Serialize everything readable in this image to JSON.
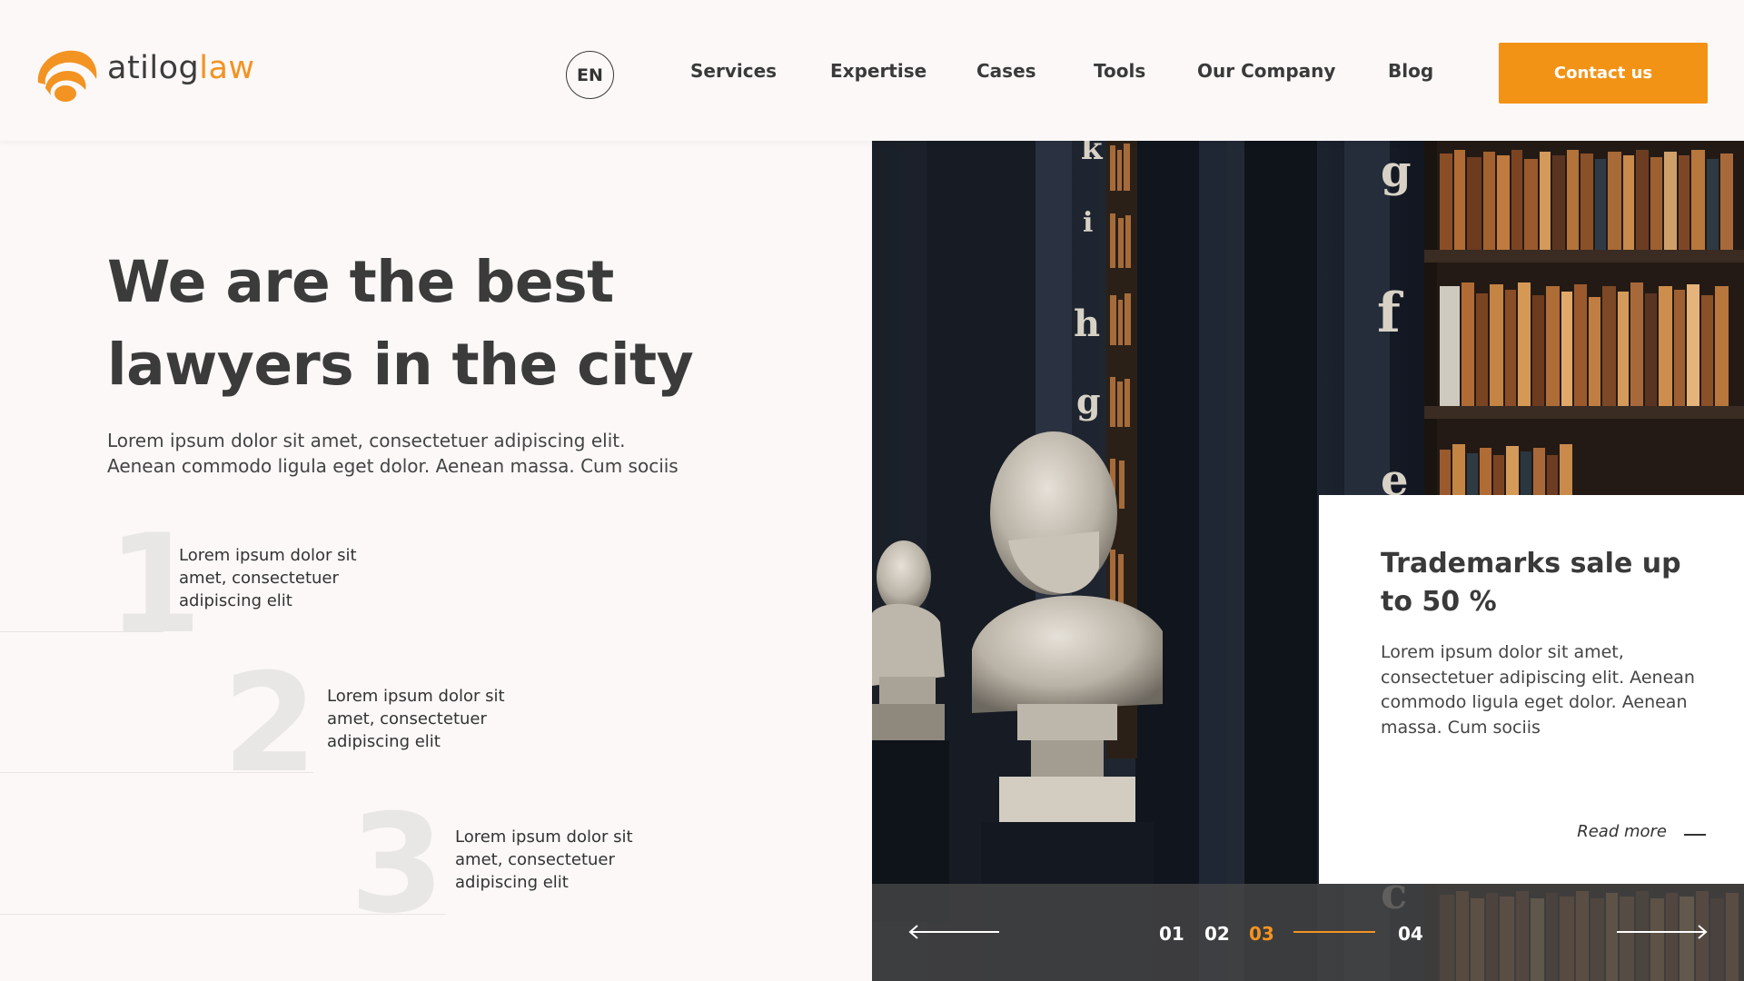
{
  "brand": {
    "name_part1": "atilog",
    "name_part2": "law",
    "accent": "#f39322",
    "logo_icon": "swirl-logo-icon"
  },
  "header": {
    "language": "EN",
    "nav": [
      "Services",
      "Expertise",
      "Cases",
      "Tools",
      "Our Company",
      "Blog"
    ],
    "contact_label": "Contact us"
  },
  "hero": {
    "title_line1": "We are the best",
    "title_line2": "lawyers in the city",
    "description": "Lorem ipsum dolor sit amet, consectetuer adipiscing elit. Aenean commodo ligula eget dolor. Aenean massa. Cum sociis"
  },
  "steps": [
    {
      "number": "1",
      "text": "Lorem ipsum dolor sit amet, consectetuer adipiscing elit"
    },
    {
      "number": "2",
      "text": "Lorem ipsum dolor sit amet, consectetuer adipiscing elit"
    },
    {
      "number": "3",
      "text": "Lorem ipsum dolor sit amet, consectetuer adipiscing elit"
    }
  ],
  "card": {
    "title": "Trademarks sale up to 50 %",
    "text": "Lorem ipsum dolor sit amet, consectetuer adipiscing elit. Aenean commodo ligula eget dolor. Aenean massa. Cum sociis",
    "read_more": "Read more"
  },
  "slider": {
    "pages": [
      "01",
      "02",
      "03",
      "04"
    ],
    "active_page": "03",
    "prev_icon": "arrow-left-icon",
    "next_icon": "arrow-right-icon"
  },
  "photo": {
    "letters": [
      "k",
      "i",
      "h",
      "g",
      "g",
      "f",
      "e",
      "c"
    ]
  }
}
